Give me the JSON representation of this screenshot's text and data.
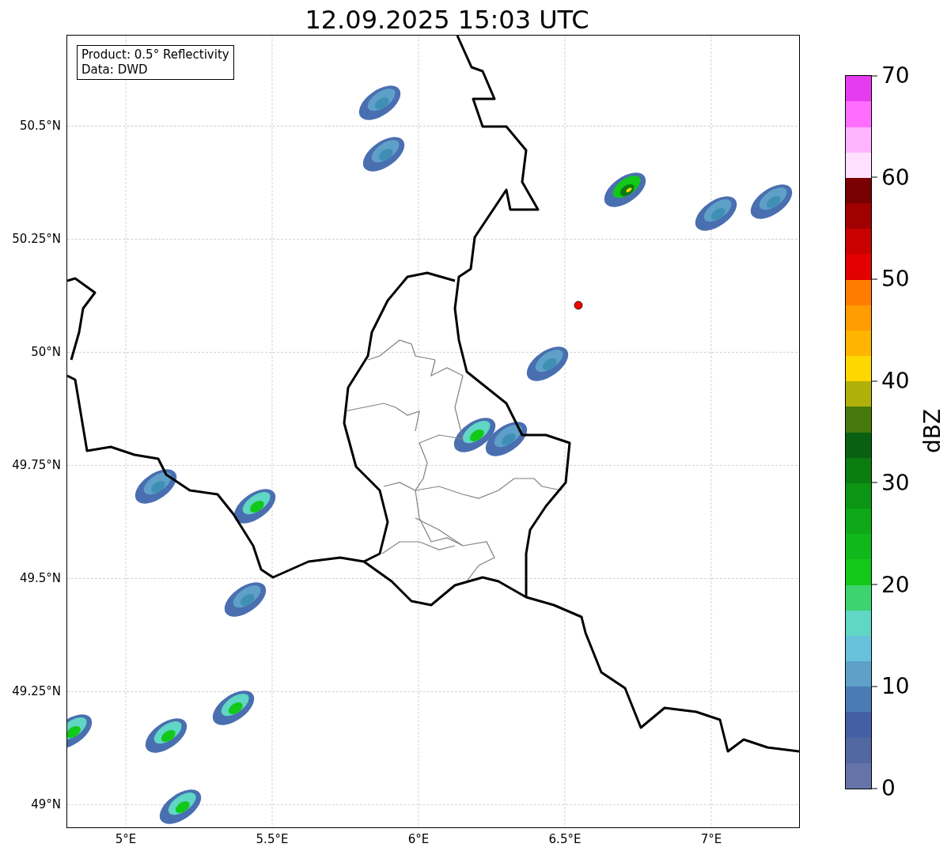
{
  "title": "12.09.2025 15:03 UTC",
  "map": {
    "xticks": [
      "5°E",
      "5.5°E",
      "6°E",
      "6.5°E",
      "7°E"
    ],
    "yticks": [
      "50.5°N",
      "50.25°N",
      "50°N",
      "49.75°N",
      "49.5°N",
      "49.25°N",
      "49°N"
    ],
    "legend": [
      "Product: 0.5° Reflectivity",
      "Data: DWD"
    ]
  },
  "colorbar": {
    "label": "dBZ",
    "ticks": [
      "70",
      "60",
      "50",
      "40",
      "30",
      "20",
      "10",
      "0"
    ],
    "bins": [
      {
        "color": "#6474a8"
      },
      {
        "color": "#5268a0"
      },
      {
        "color": "#4460a4"
      },
      {
        "color": "#4a7bb5"
      },
      {
        "color": "#5ea0c8"
      },
      {
        "color": "#68c2dc"
      },
      {
        "color": "#60d6c4"
      },
      {
        "color": "#3dd470"
      },
      {
        "color": "#12c818"
      },
      {
        "color": "#10b81c"
      },
      {
        "color": "#0ea818"
      },
      {
        "color": "#0c9414"
      },
      {
        "color": "#0a7c10"
      },
      {
        "color": "#086010"
      },
      {
        "color": "#467a0c"
      },
      {
        "color": "#b0b00a"
      },
      {
        "color": "#ffd700"
      },
      {
        "color": "#ffb400"
      },
      {
        "color": "#ff9c00"
      },
      {
        "color": "#ff7c00"
      },
      {
        "color": "#e20000"
      },
      {
        "color": "#c80000"
      },
      {
        "color": "#a00000"
      },
      {
        "color": "#780000"
      },
      {
        "color": "#ffe0ff"
      },
      {
        "color": "#ffb4ff"
      },
      {
        "color": "#ff6eff"
      },
      {
        "color": "#e63cf0"
      }
    ]
  }
}
